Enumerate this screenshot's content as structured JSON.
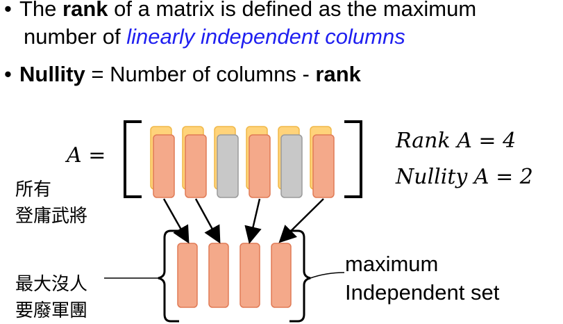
{
  "bullets": {
    "b1": {
      "prefix": "The ",
      "rank_word": "rank",
      "middle": " of a matrix is defined as the maximum",
      "line2_prefix": "number of ",
      "line2_emph": "linearly independent columns"
    },
    "b2": {
      "nullity_word": "Nullity",
      "middle": " = Number of columns - ",
      "rank_word": "rank"
    }
  },
  "matrix": {
    "label": "A =",
    "columns": [
      {
        "status": "independent"
      },
      {
        "status": "independent"
      },
      {
        "status": "dependent"
      },
      {
        "status": "independent"
      },
      {
        "status": "dependent"
      },
      {
        "status": "independent"
      }
    ]
  },
  "equations": {
    "rank": "Rank A = 4",
    "nullity": "Nullity A = 2"
  },
  "annotations": {
    "all_line1": "所有",
    "all_line2": "登庸武將",
    "min_line1": "最大沒人",
    "min_line2": "要廢軍團",
    "set_line1": "maximum",
    "set_line2": "Independent set"
  },
  "colors": {
    "independent": "#f4a98a",
    "independent_stroke": "#e07a55",
    "dependent": "#c8c8c8",
    "dependent_stroke": "#9a9a9a",
    "shadow": "#ffd37a",
    "shadow_stroke": "#f0b848",
    "emphasis_blue": "#1f1ff0"
  }
}
